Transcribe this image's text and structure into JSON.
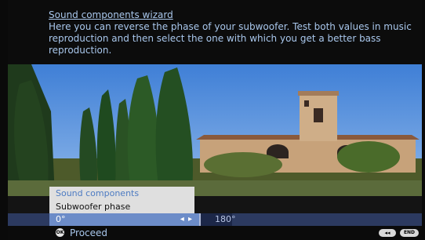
{
  "wizard": {
    "title": "Sound components wizard",
    "description": "Here you can reverse the phase of your subwoofer. Test both values in music reproduction and then select the one with which you get a better bass reproduction."
  },
  "menu": {
    "items": [
      {
        "label": "Sound components"
      },
      {
        "label": "Subwoofer phase"
      }
    ]
  },
  "selector": {
    "current_value": "0°",
    "arrows": "◂ ▸",
    "alternate_value": "180°"
  },
  "footer": {
    "ok_icon_text": "OK",
    "proceed_label": "Proceed",
    "back_button_text": "◂◂",
    "end_button_text": "END"
  },
  "colors": {
    "accent_text": "#a9c7ec",
    "selector_highlight": "#6c8cc8",
    "selector_bar": "#2c3a60"
  }
}
